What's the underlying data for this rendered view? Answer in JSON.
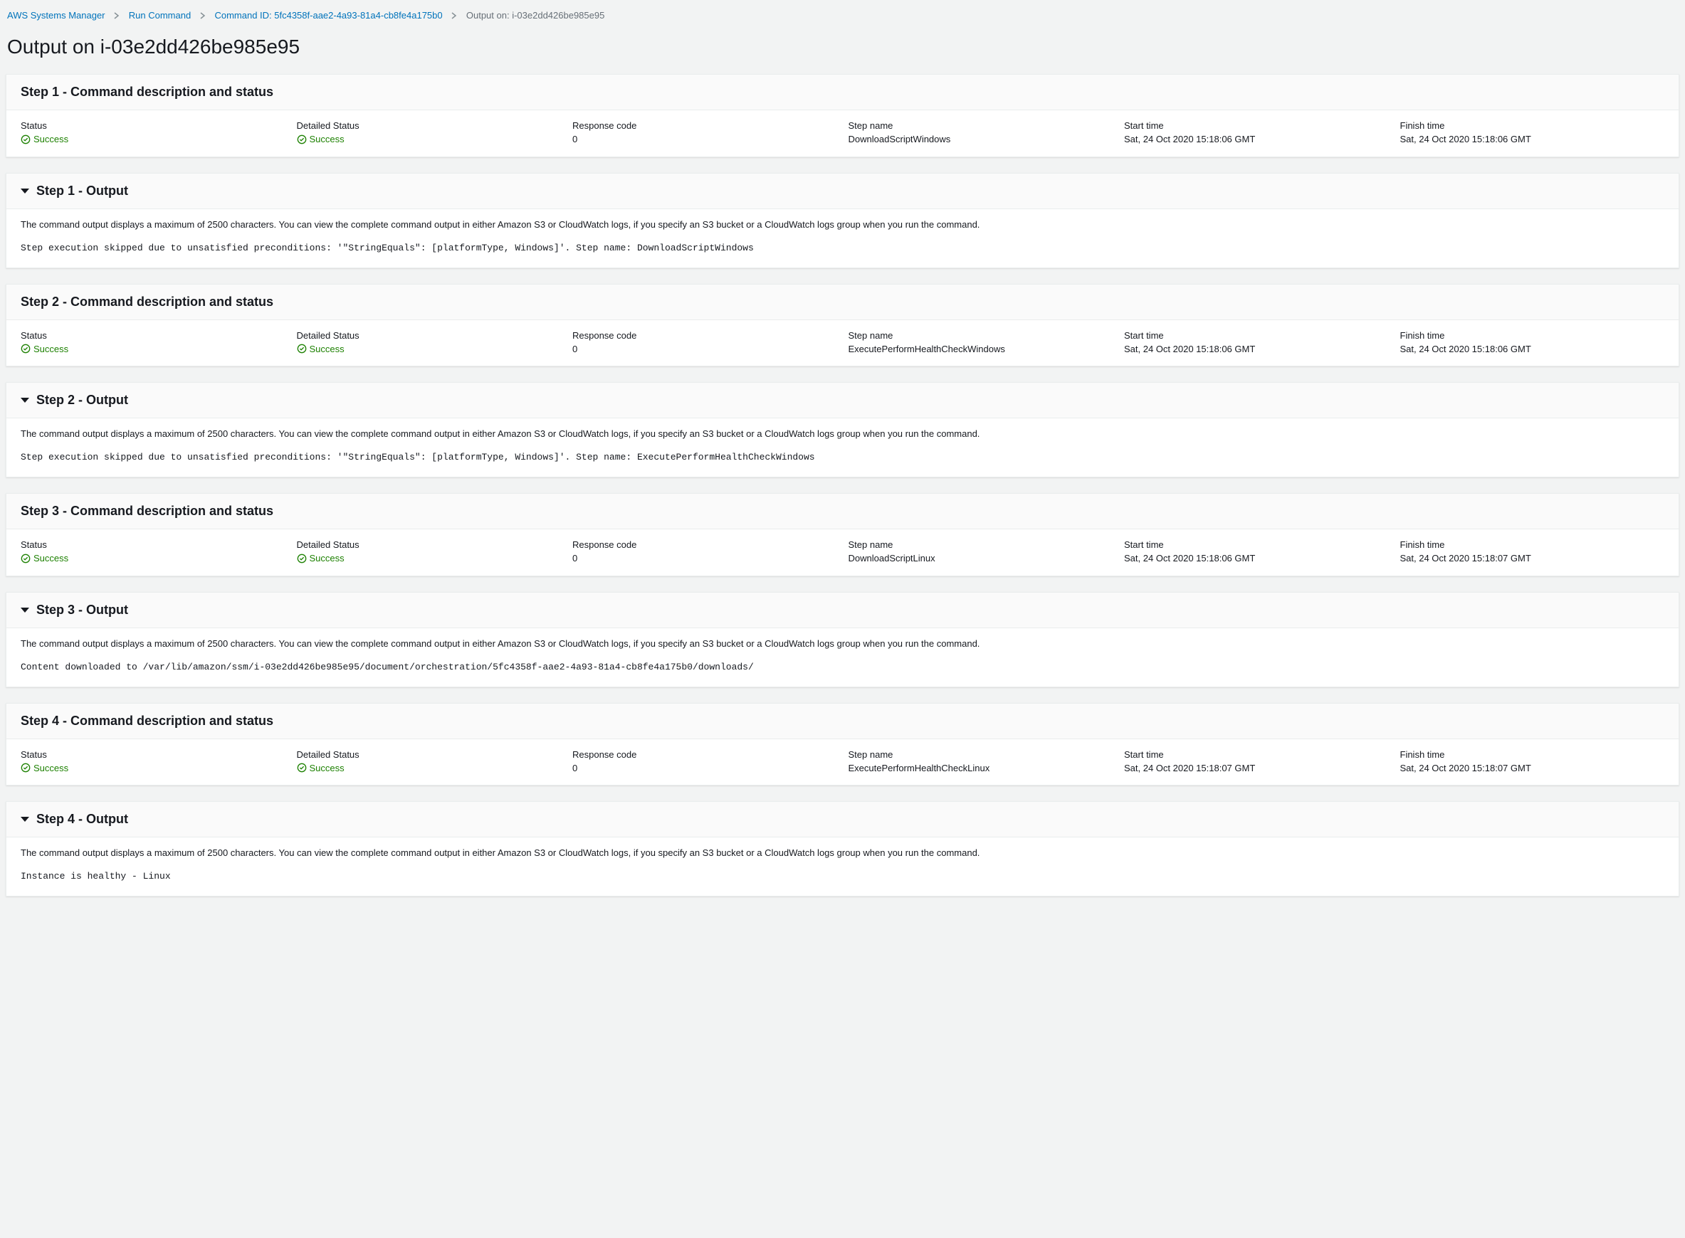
{
  "breadcrumbs": {
    "items": [
      {
        "label": "AWS Systems Manager",
        "link": true
      },
      {
        "label": "Run Command",
        "link": true
      },
      {
        "label": "Command ID: 5fc4358f-aae2-4a93-81a4-cb8fe4a175b0",
        "link": true
      },
      {
        "label": "Output on: i-03e2dd426be985e95",
        "link": false
      }
    ]
  },
  "page_title": "Output on i-03e2dd426be985e95",
  "labels": {
    "status": "Status",
    "detailed_status": "Detailed Status",
    "response_code": "Response code",
    "step_name": "Step name",
    "start_time": "Start time",
    "finish_time": "Finish time"
  },
  "output_note": "The command output displays a maximum of 2500 characters. You can view the complete command output in either Amazon S3 or CloudWatch logs, if you specify an S3 bucket or a CloudWatch logs group when you run the command.",
  "steps": [
    {
      "desc_title": "Step 1 - Command description and status",
      "output_title": "Step 1 - Output",
      "status": "Success",
      "detailed_status": "Success",
      "response_code": "0",
      "step_name": "DownloadScriptWindows",
      "start_time": "Sat, 24 Oct 2020 15:18:06 GMT",
      "finish_time": "Sat, 24 Oct 2020 15:18:06 GMT",
      "output": "Step execution skipped due to unsatisfied preconditions: '\"StringEquals\": [platformType, Windows]'. Step name: DownloadScriptWindows"
    },
    {
      "desc_title": "Step 2 - Command description and status",
      "output_title": "Step 2 - Output",
      "status": "Success",
      "detailed_status": "Success",
      "response_code": "0",
      "step_name": "ExecutePerformHealthCheckWindows",
      "start_time": "Sat, 24 Oct 2020 15:18:06 GMT",
      "finish_time": "Sat, 24 Oct 2020 15:18:06 GMT",
      "output": "Step execution skipped due to unsatisfied preconditions: '\"StringEquals\": [platformType, Windows]'. Step name: ExecutePerformHealthCheckWindows"
    },
    {
      "desc_title": "Step 3 - Command description and status",
      "output_title": "Step 3 - Output",
      "status": "Success",
      "detailed_status": "Success",
      "response_code": "0",
      "step_name": "DownloadScriptLinux",
      "start_time": "Sat, 24 Oct 2020 15:18:06 GMT",
      "finish_time": "Sat, 24 Oct 2020 15:18:07 GMT",
      "output": "Content downloaded to /var/lib/amazon/ssm/i-03e2dd426be985e95/document/orchestration/5fc4358f-aae2-4a93-81a4-cb8fe4a175b0/downloads/"
    },
    {
      "desc_title": "Step 4 - Command description and status",
      "output_title": "Step 4 - Output",
      "status": "Success",
      "detailed_status": "Success",
      "response_code": "0",
      "step_name": "ExecutePerformHealthCheckLinux",
      "start_time": "Sat, 24 Oct 2020 15:18:07 GMT",
      "finish_time": "Sat, 24 Oct 2020 15:18:07 GMT",
      "output": "Instance is healthy - Linux"
    }
  ]
}
